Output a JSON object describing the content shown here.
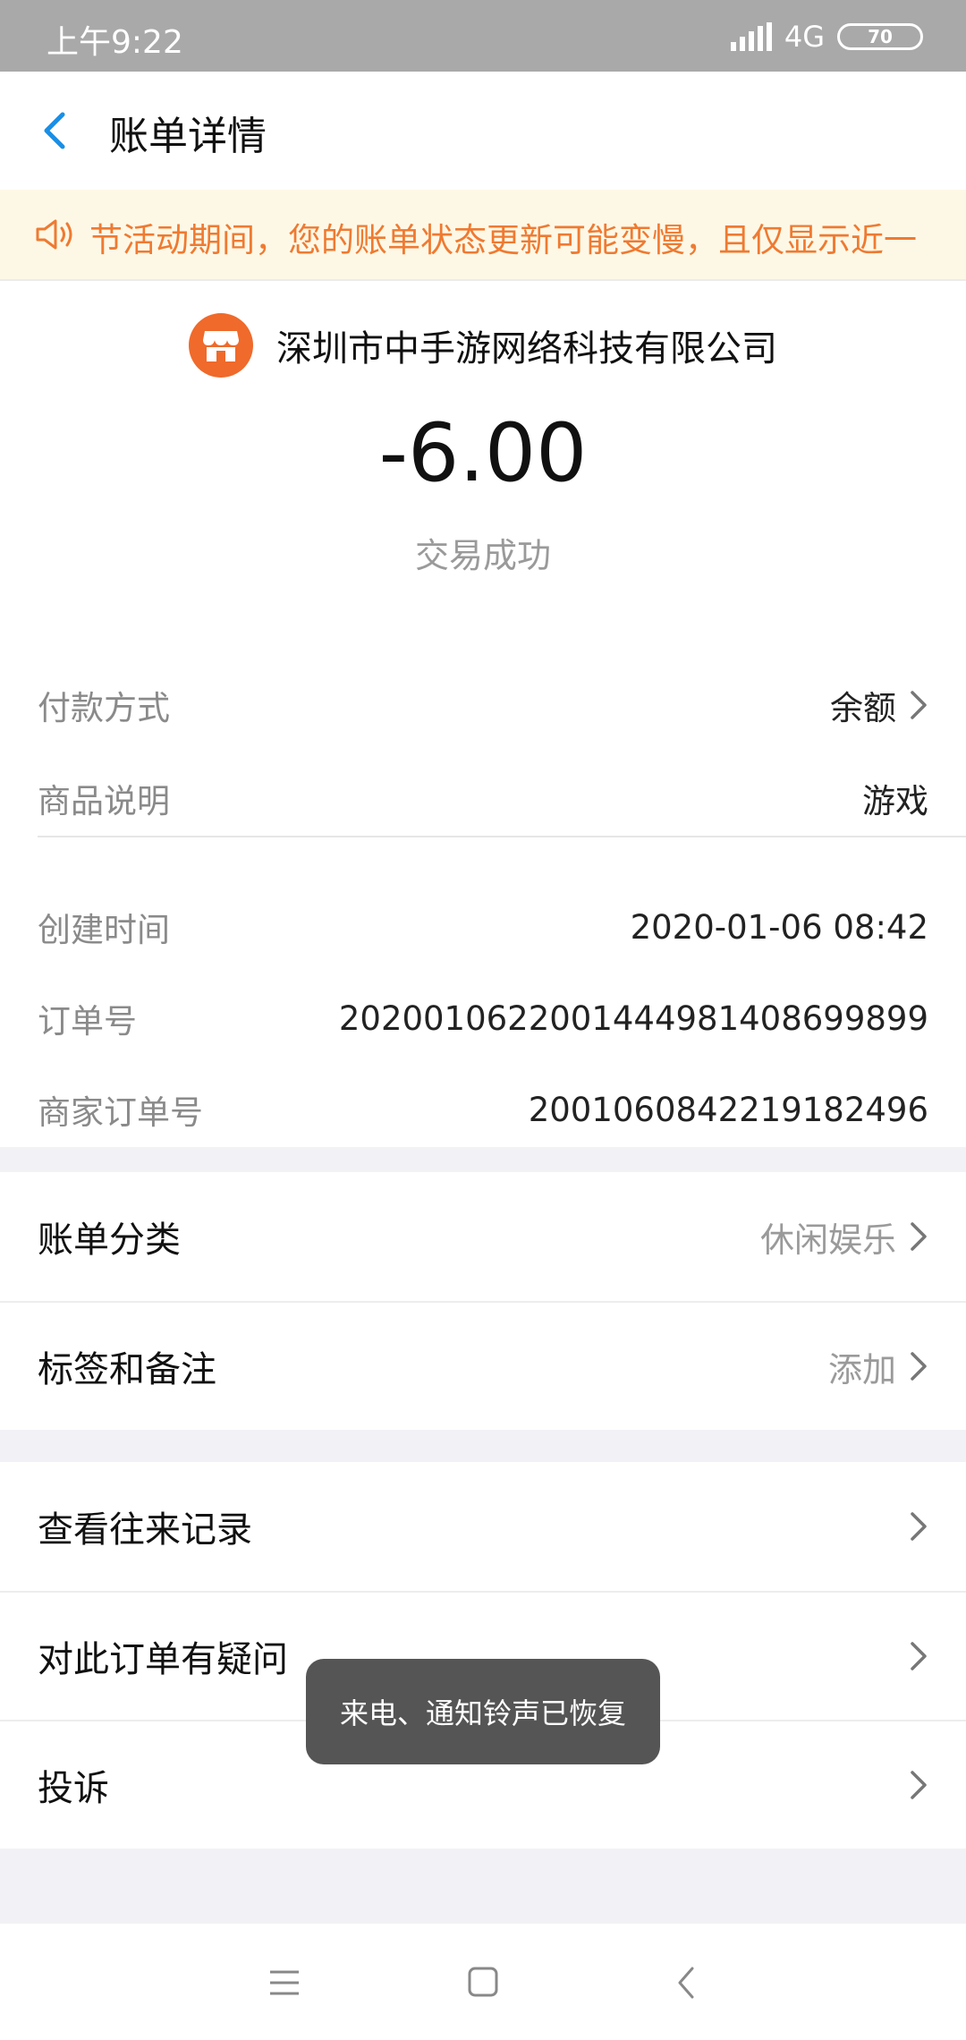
{
  "status_bar": {
    "time": "上午9:22",
    "network": "4G",
    "battery": "70"
  },
  "header": {
    "title": "账单详情",
    "back_icon": "chevron-left-icon"
  },
  "notice": {
    "icon": "speaker-icon",
    "text": "节活动期间，您的账单状态更新可能变慢，且仅显示近一"
  },
  "bill": {
    "merchant_icon": "store-icon",
    "merchant_name": "深圳市中手游网络科技有限公司",
    "amount": "-6.00",
    "status": "交易成功",
    "details": [
      {
        "label": "付款方式",
        "value": "余额",
        "has_chevron": true
      },
      {
        "label": "商品说明",
        "value": "游戏",
        "has_chevron": false
      }
    ],
    "meta": [
      {
        "label": "创建时间",
        "value": "2020-01-06 08:42"
      },
      {
        "label": "订单号",
        "value": "20200106220014449814086​99899"
      },
      {
        "label": "商家订单号",
        "value": "2001060842219182496"
      }
    ]
  },
  "category_group": [
    {
      "label": "账单分类",
      "value": "休闲娱乐"
    },
    {
      "label": "标签和备注",
      "value": "添加"
    }
  ],
  "action_group": [
    {
      "label": "查看往来记录"
    },
    {
      "label": "对此订单有疑问"
    },
    {
      "label": "投诉"
    }
  ],
  "toast": {
    "text": "来电、通知铃声已恢复"
  },
  "colors": {
    "accent_blue": "#1a8fe5",
    "notice_orange": "#ef7a31",
    "merchant_orange": "#ef6a2b"
  }
}
